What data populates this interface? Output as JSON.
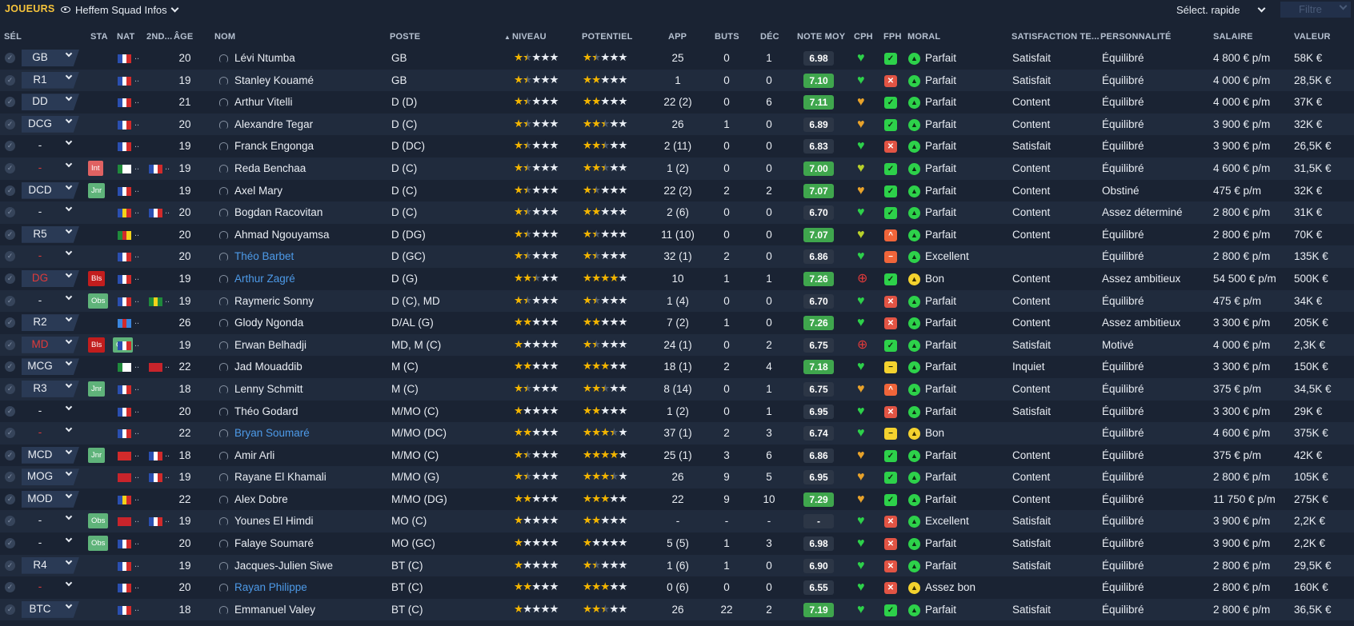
{
  "topbar": {
    "section": "JOUEURS",
    "view": "Heffem Squad Infos",
    "quick_select": "Sélect. rapide",
    "filter": "Filtre"
  },
  "colors": {
    "accent": "#f5c33b",
    "link": "#4d9ae8",
    "good_note": "#3fa64d",
    "red": "#e03a3a"
  },
  "columns": {
    "sel": "SÉL",
    "sta": "STA",
    "nat": "NAT",
    "nd": "2ND...",
    "age": "ÂGE",
    "nom": "NOM",
    "poste": "POSTE",
    "niveau": "NIVEAU",
    "potentiel": "POTENTIEL",
    "app": "APP",
    "buts": "BUTS",
    "dec": "DÉC",
    "note": "NOTE MOY",
    "cph": "CPH",
    "fph": "FPH",
    "moral": "MORAL",
    "sat": "SATISFACTION TE...",
    "pers": "PERSONNALITÉ",
    "salaire": "SALAIRE",
    "valeur": "VALEUR"
  },
  "players": [
    {
      "sel": "GB",
      "sel_red": false,
      "sta": [],
      "flag": "fr",
      "flag2": "",
      "age": "20",
      "name": "Lévi Ntumba",
      "link": false,
      "poste": "GB",
      "niv": 1.5,
      "pot": 1.5,
      "app": "25",
      "buts": "0",
      "dec": "1",
      "note": "6.98",
      "note_good": false,
      "cph": "green",
      "fph": "gr",
      "fph_icon": "✓",
      "moral_icon": "gr",
      "moral": "Parfait",
      "sat": "Satisfait",
      "pers": "Équilibré",
      "salaire": "4 800 € p/m",
      "valeur": "58K €"
    },
    {
      "sel": "R1",
      "sel_red": false,
      "sta": [],
      "flag": "fr",
      "flag2": "",
      "age": "19",
      "name": "Stanley Kouamé",
      "link": false,
      "poste": "GB",
      "niv": 1.5,
      "pot": 2,
      "app": "1",
      "buts": "0",
      "dec": "0",
      "note": "7.10",
      "note_good": true,
      "cph": "green",
      "fph": "rd",
      "fph_icon": "✕",
      "moral_icon": "gr",
      "moral": "Parfait",
      "sat": "Satisfait",
      "pers": "Équilibré",
      "salaire": "4 000 € p/m",
      "valeur": "28,5K €"
    },
    {
      "sel": "DD",
      "sel_red": false,
      "sta": [],
      "flag": "fr",
      "flag2": "",
      "age": "21",
      "name": "Arthur Vitelli",
      "link": false,
      "poste": "D (D)",
      "niv": 1.5,
      "pot": 2,
      "app": "22 (2)",
      "buts": "0",
      "dec": "6",
      "note": "7.11",
      "note_good": true,
      "cph": "orange",
      "fph": "gr",
      "fph_icon": "✓",
      "moral_icon": "gr",
      "moral": "Parfait",
      "sat": "Content",
      "pers": "Équilibré",
      "salaire": "4 000 € p/m",
      "valeur": "37K €"
    },
    {
      "sel": "DCG",
      "sel_red": false,
      "sta": [],
      "flag": "fr",
      "flag2": "",
      "age": "20",
      "name": "Alexandre Tegar",
      "link": false,
      "poste": "D (C)",
      "niv": 1.5,
      "pot": 2.5,
      "app": "26",
      "buts": "1",
      "dec": "0",
      "note": "6.89",
      "note_good": false,
      "cph": "orange",
      "fph": "gr",
      "fph_icon": "✓",
      "moral_icon": "gr",
      "moral": "Parfait",
      "sat": "Content",
      "pers": "Équilibré",
      "salaire": "3 900 € p/m",
      "valeur": "32K €"
    },
    {
      "sel": "-",
      "sel_red": false,
      "sta": [],
      "flag": "fr",
      "flag2": "",
      "age": "19",
      "name": "Franck Engonga",
      "link": false,
      "poste": "D (DC)",
      "niv": 1.5,
      "pot": 2.5,
      "app": "2 (11)",
      "buts": "0",
      "dec": "0",
      "note": "6.83",
      "note_good": false,
      "cph": "green",
      "fph": "rd",
      "fph_icon": "✕",
      "moral_icon": "gr",
      "moral": "Parfait",
      "sat": "Satisfait",
      "pers": "Équilibré",
      "salaire": "3 900 € p/m",
      "valeur": "26,5K €"
    },
    {
      "sel": "-",
      "sel_red": true,
      "sta": [
        "Int"
      ],
      "flag": "dz",
      "flag2": "fr",
      "age": "19",
      "name": "Reda Benchaa",
      "link": false,
      "poste": "D (C)",
      "niv": 1.5,
      "pot": 2.5,
      "app": "1 (2)",
      "buts": "0",
      "dec": "0",
      "note": "7.00",
      "note_good": true,
      "cph": "yellow",
      "fph": "gr",
      "fph_icon": "✓",
      "moral_icon": "gr",
      "moral": "Parfait",
      "sat": "Content",
      "pers": "Équilibré",
      "salaire": "4 600 € p/m",
      "valeur": "31,5K €"
    },
    {
      "sel": "DCD",
      "sel_red": false,
      "sta": [
        "Jnr"
      ],
      "flag": "fr",
      "flag2": "",
      "age": "19",
      "name": "Axel Mary",
      "link": false,
      "poste": "D (C)",
      "niv": 1.5,
      "pot": 1.5,
      "app": "22 (2)",
      "buts": "2",
      "dec": "2",
      "note": "7.07",
      "note_good": true,
      "cph": "orange",
      "fph": "gr",
      "fph_icon": "✓",
      "moral_icon": "gr",
      "moral": "Parfait",
      "sat": "Content",
      "pers": "Obstiné",
      "salaire": "475 € p/m",
      "valeur": "32K €"
    },
    {
      "sel": "-",
      "sel_red": false,
      "sta": [],
      "flag": "ro",
      "flag2": "fr",
      "age": "20",
      "name": "Bogdan Racovitan",
      "link": false,
      "poste": "D (C)",
      "niv": 1.5,
      "pot": 2,
      "app": "2 (6)",
      "buts": "0",
      "dec": "0",
      "note": "6.70",
      "note_good": false,
      "cph": "green",
      "fph": "gr",
      "fph_icon": "✓",
      "moral_icon": "gr",
      "moral": "Parfait",
      "sat": "Content",
      "pers": "Assez déterminé",
      "salaire": "2 800 € p/m",
      "valeur": "31K €"
    },
    {
      "sel": "R5",
      "sel_red": false,
      "sta": [],
      "flag": "cm",
      "flag2": "",
      "age": "20",
      "name": "Ahmad Ngouyamsa",
      "link": false,
      "poste": "D (DG)",
      "niv": 1.5,
      "pot": 1.5,
      "app": "11 (10)",
      "buts": "0",
      "dec": "0",
      "note": "7.07",
      "note_good": true,
      "cph": "yellow",
      "fph": "or",
      "fph_icon": "^",
      "moral_icon": "gr",
      "moral": "Parfait",
      "sat": "Content",
      "pers": "Équilibré",
      "salaire": "2 800 € p/m",
      "valeur": "70K €"
    },
    {
      "sel": "-",
      "sel_red": true,
      "sta": [],
      "flag": "fr",
      "flag2": "",
      "age": "20",
      "name": "Théo Barbet",
      "link": true,
      "poste": "D (GC)",
      "niv": 1.5,
      "pot": 1.5,
      "app": "32 (1)",
      "buts": "2",
      "dec": "0",
      "note": "6.86",
      "note_good": false,
      "cph": "green",
      "fph": "or",
      "fph_icon": "−",
      "moral_icon": "gr",
      "moral": "Excellent",
      "sat": "",
      "pers": "Équilibré",
      "salaire": "2 800 € p/m",
      "valeur": "135K €"
    },
    {
      "sel": "DG",
      "sel_red": true,
      "sta": [
        "Bls"
      ],
      "flag": "fr",
      "flag2": "",
      "age": "19",
      "name": "Arthur Zagré",
      "link": true,
      "poste": "D (G)",
      "niv": 2.5,
      "pot": 4,
      "app": "10",
      "buts": "1",
      "dec": "1",
      "note": "7.26",
      "note_good": true,
      "cph": "red",
      "fph": "gr",
      "fph_icon": "✓",
      "moral_icon": "ye",
      "moral": "Bon",
      "sat": "Content",
      "pers": "Assez ambitieux",
      "salaire": "54 500 € p/m",
      "valeur": "500K €"
    },
    {
      "sel": "-",
      "sel_red": false,
      "sta": [
        "Obs"
      ],
      "flag": "fr",
      "flag2": "gy",
      "age": "19",
      "name": "Raymeric Sonny",
      "link": false,
      "poste": "D (C), MD",
      "niv": 1.5,
      "pot": 1.5,
      "app": "1 (4)",
      "buts": "0",
      "dec": "0",
      "note": "6.70",
      "note_good": false,
      "cph": "green",
      "fph": "rd",
      "fph_icon": "✕",
      "moral_icon": "gr",
      "moral": "Parfait",
      "sat": "Content",
      "pers": "Équilibré",
      "salaire": "475 € p/m",
      "valeur": "34K €"
    },
    {
      "sel": "R2",
      "sel_red": false,
      "sta": [],
      "flag": "cd",
      "flag2": "",
      "age": "26",
      "name": "Glody Ngonda",
      "link": false,
      "poste": "D/AL (G)",
      "niv": 2,
      "pot": 2,
      "app": "7 (2)",
      "buts": "1",
      "dec": "0",
      "note": "7.26",
      "note_good": true,
      "cph": "green",
      "fph": "rd",
      "fph_icon": "✕",
      "moral_icon": "gr",
      "moral": "Parfait",
      "sat": "Content",
      "pers": "Assez ambitieux",
      "salaire": "3 300 € p/m",
      "valeur": "205K €"
    },
    {
      "sel": "MD",
      "sel_red": true,
      "sta": [
        "Bls",
        "Obs"
      ],
      "flag": "fr",
      "flag2": "",
      "age": "19",
      "name": "Erwan Belhadji",
      "link": false,
      "poste": "MD, M (C)",
      "niv": 1,
      "pot": 1.5,
      "app": "24 (1)",
      "buts": "0",
      "dec": "2",
      "note": "6.75",
      "note_good": false,
      "cph": "red",
      "fph": "gr",
      "fph_icon": "✓",
      "moral_icon": "gr",
      "moral": "Parfait",
      "sat": "Satisfait",
      "pers": "Motivé",
      "salaire": "4 000 € p/m",
      "valeur": "2,3K €"
    },
    {
      "sel": "MCG",
      "sel_red": false,
      "sta": [],
      "flag": "dz",
      "flag2": "ma",
      "age": "22",
      "name": "Jad Mouaddib",
      "link": false,
      "poste": "M (C)",
      "niv": 2,
      "pot": 3,
      "app": "18 (1)",
      "buts": "2",
      "dec": "4",
      "note": "7.18",
      "note_good": true,
      "cph": "green",
      "fph": "ye",
      "fph_icon": "−",
      "moral_icon": "gr",
      "moral": "Parfait",
      "sat": "Inquiet",
      "pers": "Équilibré",
      "salaire": "3 300 € p/m",
      "valeur": "150K €"
    },
    {
      "sel": "R3",
      "sel_red": false,
      "sta": [
        "Jnr"
      ],
      "flag": "fr",
      "flag2": "",
      "age": "18",
      "name": "Lenny Schmitt",
      "link": false,
      "poste": "M (C)",
      "niv": 1.5,
      "pot": 2.5,
      "app": "8 (14)",
      "buts": "0",
      "dec": "1",
      "note": "6.75",
      "note_good": false,
      "cph": "orange",
      "fph": "or",
      "fph_icon": "^",
      "moral_icon": "gr",
      "moral": "Parfait",
      "sat": "Content",
      "pers": "Équilibré",
      "salaire": "375 € p/m",
      "valeur": "34,5K €"
    },
    {
      "sel": "-",
      "sel_red": false,
      "sta": [],
      "flag": "fr",
      "flag2": "",
      "age": "20",
      "name": "Théo Godard",
      "link": false,
      "poste": "M/MO (C)",
      "niv": 1,
      "pot": 2,
      "app": "1 (2)",
      "buts": "0",
      "dec": "1",
      "note": "6.95",
      "note_good": false,
      "cph": "green",
      "fph": "rd",
      "fph_icon": "✕",
      "moral_icon": "gr",
      "moral": "Parfait",
      "sat": "Satisfait",
      "pers": "Équilibré",
      "salaire": "3 300 € p/m",
      "valeur": "29K €"
    },
    {
      "sel": "-",
      "sel_red": true,
      "sta": [],
      "flag": "fr",
      "flag2": "",
      "age": "22",
      "name": "Bryan Soumaré",
      "link": true,
      "poste": "M/MO (DC)",
      "niv": 2,
      "pot": 3.5,
      "app": "37 (1)",
      "buts": "2",
      "dec": "3",
      "note": "6.74",
      "note_good": false,
      "cph": "green",
      "fph": "ye",
      "fph_icon": "−",
      "moral_icon": "ye",
      "moral": "Bon",
      "sat": "",
      "pers": "Équilibré",
      "salaire": "4 600 € p/m",
      "valeur": "375K €"
    },
    {
      "sel": "MCD",
      "sel_red": false,
      "sta": [
        "Jnr"
      ],
      "flag": "tr",
      "flag2": "fr",
      "age": "18",
      "name": "Amir Arli",
      "link": false,
      "poste": "M/MO (C)",
      "niv": 1.5,
      "pot": 4,
      "app": "25 (1)",
      "buts": "3",
      "dec": "6",
      "note": "6.86",
      "note_good": false,
      "cph": "orange",
      "fph": "gr",
      "fph_icon": "✓",
      "moral_icon": "gr",
      "moral": "Parfait",
      "sat": "Content",
      "pers": "Équilibré",
      "salaire": "375 € p/m",
      "valeur": "42K €"
    },
    {
      "sel": "MOG",
      "sel_red": false,
      "sta": [],
      "flag": "ma",
      "flag2": "fr",
      "age": "19",
      "name": "Rayane El Khamali",
      "link": false,
      "poste": "M/MO (G)",
      "niv": 1.5,
      "pot": 3.5,
      "app": "26",
      "buts": "9",
      "dec": "5",
      "note": "6.95",
      "note_good": false,
      "cph": "orange",
      "fph": "gr",
      "fph_icon": "✓",
      "moral_icon": "gr",
      "moral": "Parfait",
      "sat": "Content",
      "pers": "Équilibré",
      "salaire": "2 800 € p/m",
      "valeur": "105K €"
    },
    {
      "sel": "MOD",
      "sel_red": false,
      "sta": [],
      "flag": "ro",
      "flag2": "",
      "age": "22",
      "name": "Alex Dobre",
      "link": false,
      "poste": "M/MO (DG)",
      "niv": 2,
      "pot": 3,
      "app": "22",
      "buts": "9",
      "dec": "10",
      "note": "7.29",
      "note_good": true,
      "cph": "orange",
      "fph": "gr",
      "fph_icon": "✓",
      "moral_icon": "gr",
      "moral": "Parfait",
      "sat": "Content",
      "pers": "Équilibré",
      "salaire": "11 750 € p/m",
      "valeur": "275K €"
    },
    {
      "sel": "-",
      "sel_red": false,
      "sta": [
        "Obs"
      ],
      "flag": "ma",
      "flag2": "fr",
      "age": "19",
      "name": "Younes El Himdi",
      "link": false,
      "poste": "MO (C)",
      "niv": 1,
      "pot": 2,
      "app": "-",
      "buts": "-",
      "dec": "-",
      "note": "-",
      "note_good": false,
      "cph": "green",
      "fph": "rd",
      "fph_icon": "✕",
      "moral_icon": "gr",
      "moral": "Excellent",
      "sat": "Satisfait",
      "pers": "Équilibré",
      "salaire": "3 900 € p/m",
      "valeur": "2,2K €"
    },
    {
      "sel": "-",
      "sel_red": false,
      "sta": [
        "Obs"
      ],
      "flag": "fr",
      "flag2": "",
      "age": "20",
      "name": "Falaye Soumaré",
      "link": false,
      "poste": "MO (GC)",
      "niv": 1,
      "pot": 1,
      "app": "5 (5)",
      "buts": "1",
      "dec": "3",
      "note": "6.98",
      "note_good": false,
      "cph": "green",
      "fph": "rd",
      "fph_icon": "✕",
      "moral_icon": "gr",
      "moral": "Parfait",
      "sat": "Satisfait",
      "pers": "Équilibré",
      "salaire": "3 900 € p/m",
      "valeur": "2,2K €"
    },
    {
      "sel": "R4",
      "sel_red": false,
      "sta": [],
      "flag": "fr",
      "flag2": "",
      "age": "19",
      "name": "Jacques-Julien Siwe",
      "link": false,
      "poste": "BT (C)",
      "niv": 1,
      "pot": 1.5,
      "app": "1 (6)",
      "buts": "1",
      "dec": "0",
      "note": "6.90",
      "note_good": false,
      "cph": "green",
      "fph": "rd",
      "fph_icon": "✕",
      "moral_icon": "gr",
      "moral": "Parfait",
      "sat": "Satisfait",
      "pers": "Équilibré",
      "salaire": "2 800 € p/m",
      "valeur": "29,5K €"
    },
    {
      "sel": "-",
      "sel_red": true,
      "sta": [],
      "flag": "fr",
      "flag2": "",
      "age": "20",
      "name": "Rayan Philippe",
      "link": true,
      "poste": "BT (C)",
      "niv": 2,
      "pot": 3,
      "app": "0 (6)",
      "buts": "0",
      "dec": "0",
      "note": "6.55",
      "note_good": false,
      "cph": "green",
      "fph": "rd",
      "fph_icon": "✕",
      "moral_icon": "ye",
      "moral": "Assez bon",
      "sat": "",
      "pers": "Équilibré",
      "salaire": "2 800 € p/m",
      "valeur": "160K €"
    },
    {
      "sel": "BTC",
      "sel_red": false,
      "sta": [],
      "flag": "fr",
      "flag2": "",
      "age": "18",
      "name": "Emmanuel Valey",
      "link": false,
      "poste": "BT (C)",
      "niv": 1,
      "pot": 2.5,
      "app": "26",
      "buts": "22",
      "dec": "2",
      "note": "7.19",
      "note_good": true,
      "cph": "green",
      "fph": "gr",
      "fph_icon": "✓",
      "moral_icon": "gr",
      "moral": "Parfait",
      "sat": "Satisfait",
      "pers": "Équilibré",
      "salaire": "2 800 € p/m",
      "valeur": "36,5K €"
    }
  ]
}
